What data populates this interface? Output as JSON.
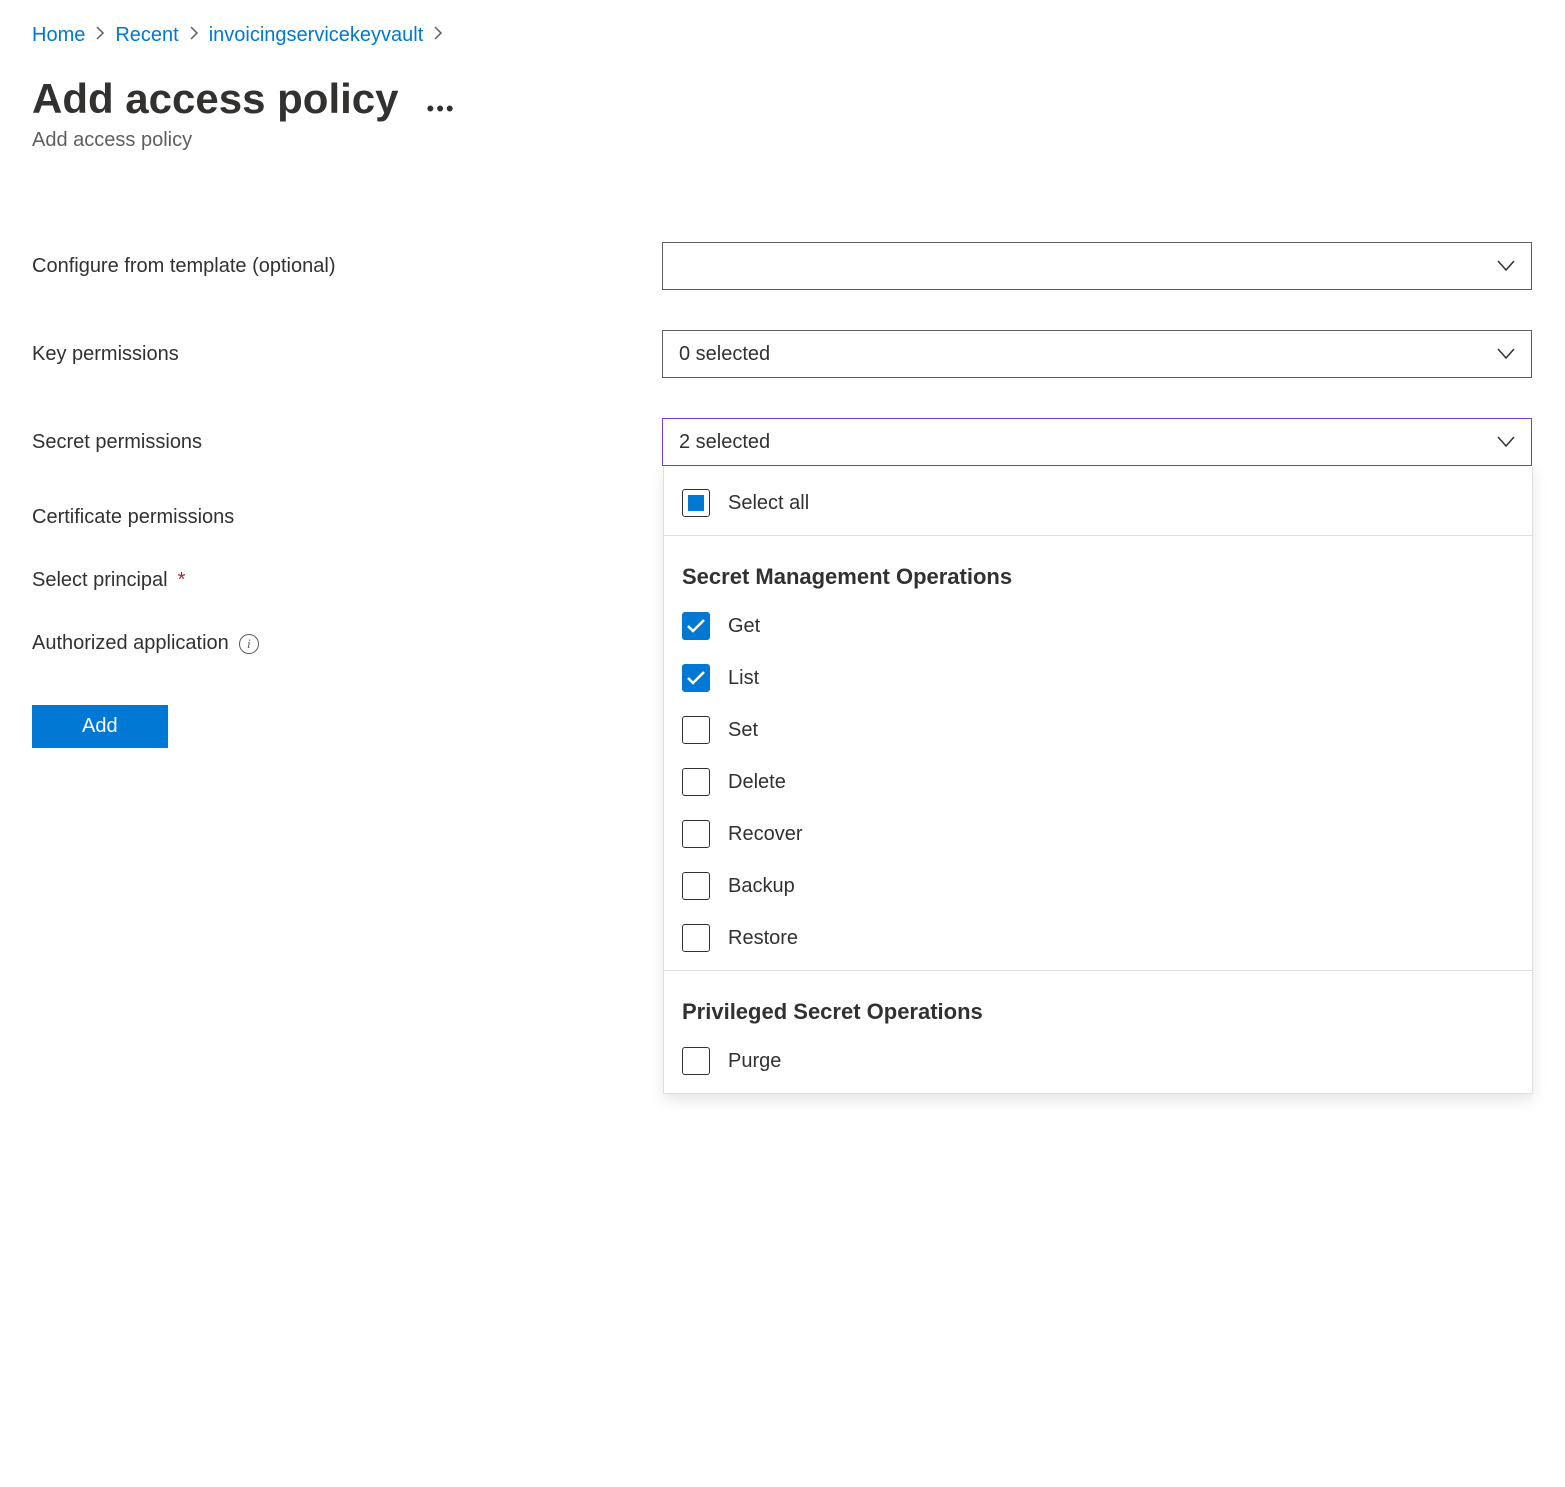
{
  "breadcrumb": {
    "items": [
      {
        "label": "Home"
      },
      {
        "label": "Recent"
      },
      {
        "label": "invoicingservicekeyvault"
      }
    ]
  },
  "header": {
    "title": "Add access policy",
    "subtitle": "Add access policy"
  },
  "form": {
    "template_label": "Configure from template (optional)",
    "template_value": "",
    "key_perm_label": "Key permissions",
    "key_perm_value": "0 selected",
    "secret_perm_label": "Secret permissions",
    "secret_perm_value": "2 selected",
    "cert_perm_label": "Certificate permissions",
    "principal_label": "Select principal",
    "auth_app_label": "Authorized application",
    "add_button": "Add"
  },
  "secret_dropdown": {
    "select_all_label": "Select all",
    "select_all_state": "indeterminate",
    "groups": [
      {
        "heading": "Secret Management Operations",
        "options": [
          {
            "label": "Get",
            "checked": true
          },
          {
            "label": "List",
            "checked": true
          },
          {
            "label": "Set",
            "checked": false
          },
          {
            "label": "Delete",
            "checked": false
          },
          {
            "label": "Recover",
            "checked": false
          },
          {
            "label": "Backup",
            "checked": false
          },
          {
            "label": "Restore",
            "checked": false
          }
        ]
      },
      {
        "heading": "Privileged Secret Operations",
        "options": [
          {
            "label": "Purge",
            "checked": false
          }
        ]
      }
    ]
  },
  "colors": {
    "accent": "#0078d4",
    "active_border": "#773adc"
  }
}
